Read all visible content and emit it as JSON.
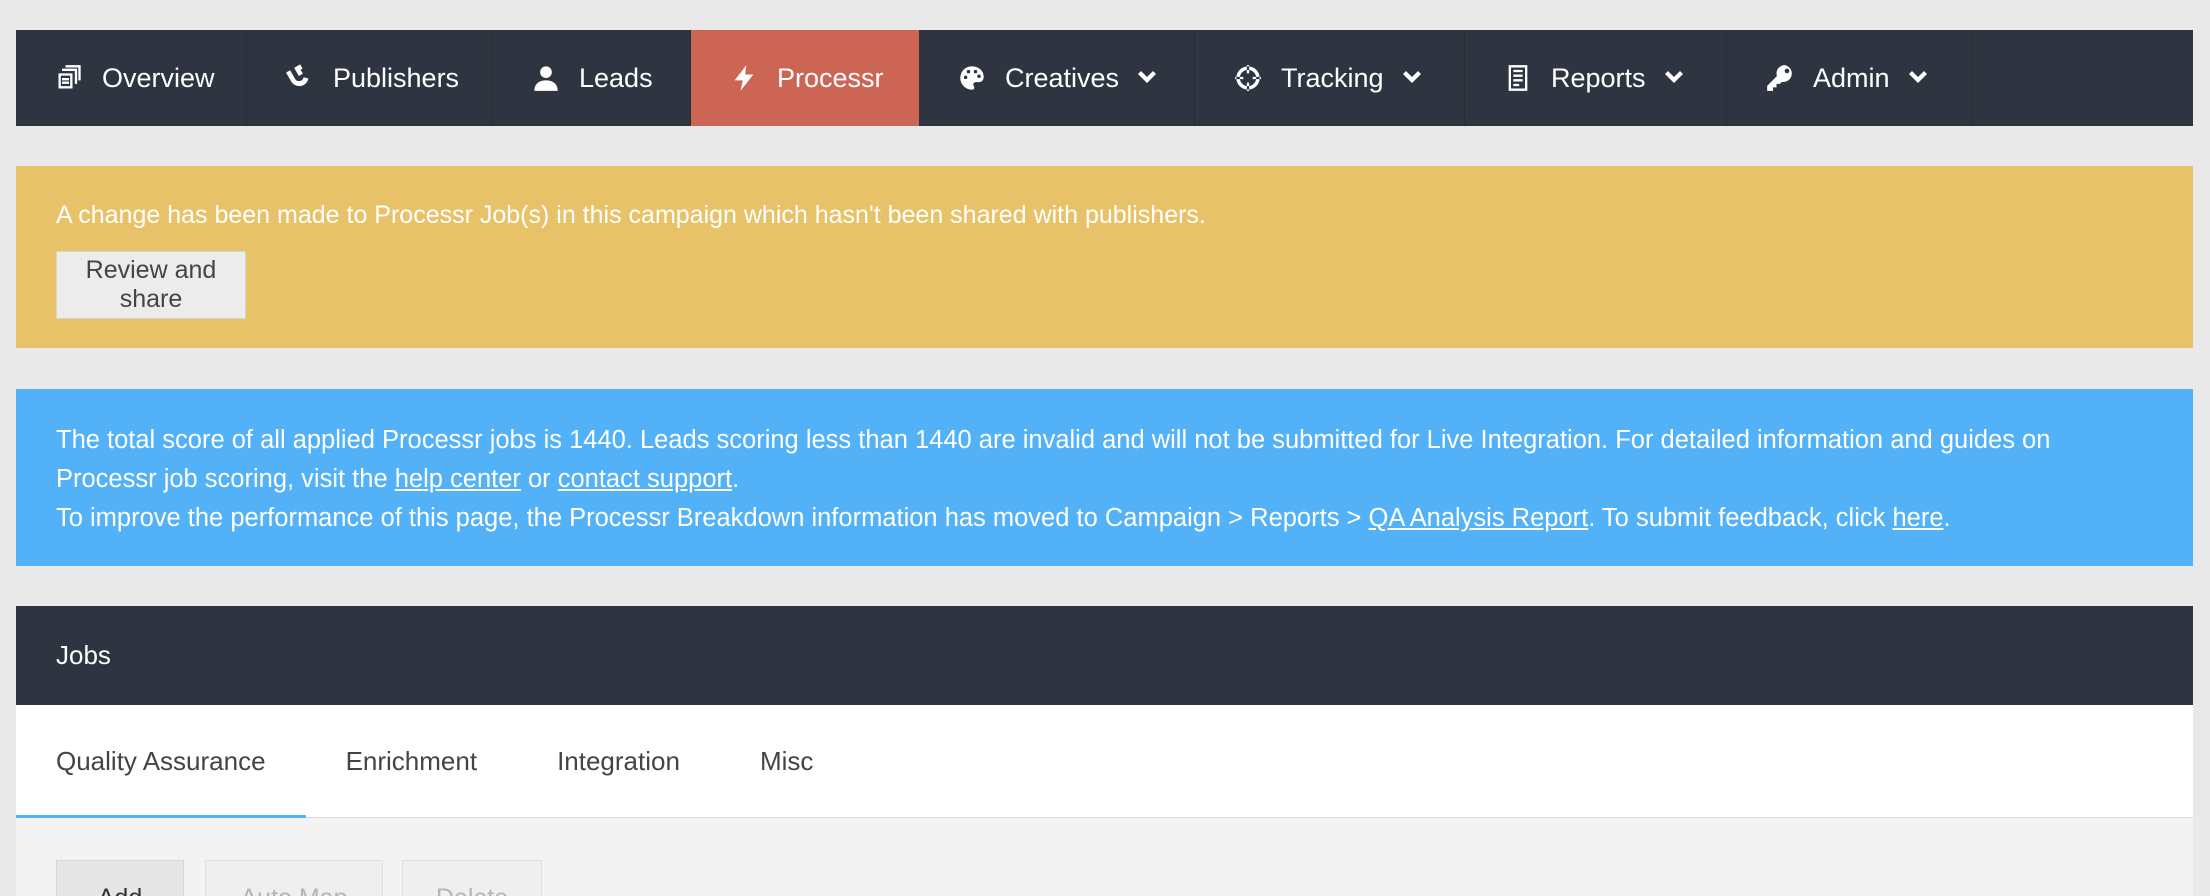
{
  "nav": {
    "items": [
      {
        "label": "Overview",
        "icon": "overview-icon"
      },
      {
        "label": "Publishers",
        "icon": "magnet-icon"
      },
      {
        "label": "Leads",
        "icon": "user-icon"
      },
      {
        "label": "Processr",
        "icon": "bolt-icon",
        "active": true
      },
      {
        "label": "Creatives",
        "icon": "palette-icon",
        "dropdown": true
      },
      {
        "label": "Tracking",
        "icon": "crosshairs-icon",
        "dropdown": true
      },
      {
        "label": "Reports",
        "icon": "report-icon",
        "dropdown": true
      },
      {
        "label": "Admin",
        "icon": "key-icon",
        "dropdown": true
      }
    ]
  },
  "warning": {
    "message": "A change has been made to Processr Job(s) in this campaign which hasn't been shared with publishers.",
    "button_label": "Review and share"
  },
  "info": {
    "line1_a": "The total score of all applied Processr jobs is 1440. Leads scoring less than 1440 are invalid and will not be submitted for Live Integration. For detailed information and guides on Processr job scoring, visit the ",
    "link_help": "help center",
    "or": " or ",
    "link_support": "contact support",
    "period1": ".",
    "line2_a": "To improve the performance of this page, the Processr Breakdown information has moved to Campaign > Reports > ",
    "link_qa": "QA Analysis Report",
    "line2_b": ". To submit feedback, click ",
    "link_here": "here",
    "period2": "."
  },
  "jobs": {
    "title": "Jobs",
    "tabs": [
      "Quality Assurance",
      "Enrichment",
      "Integration",
      "Misc"
    ],
    "active_tab": "Quality Assurance",
    "toolbar": {
      "add": "Add",
      "auto_map": "Auto Map",
      "delete": "Delete"
    }
  },
  "colors": {
    "nav_bg": "#2e3440",
    "active_nav": "#cd6555",
    "warning_bg": "#e8c268",
    "info_bg": "#52b1f7",
    "tab_underline": "#52b1f7"
  }
}
